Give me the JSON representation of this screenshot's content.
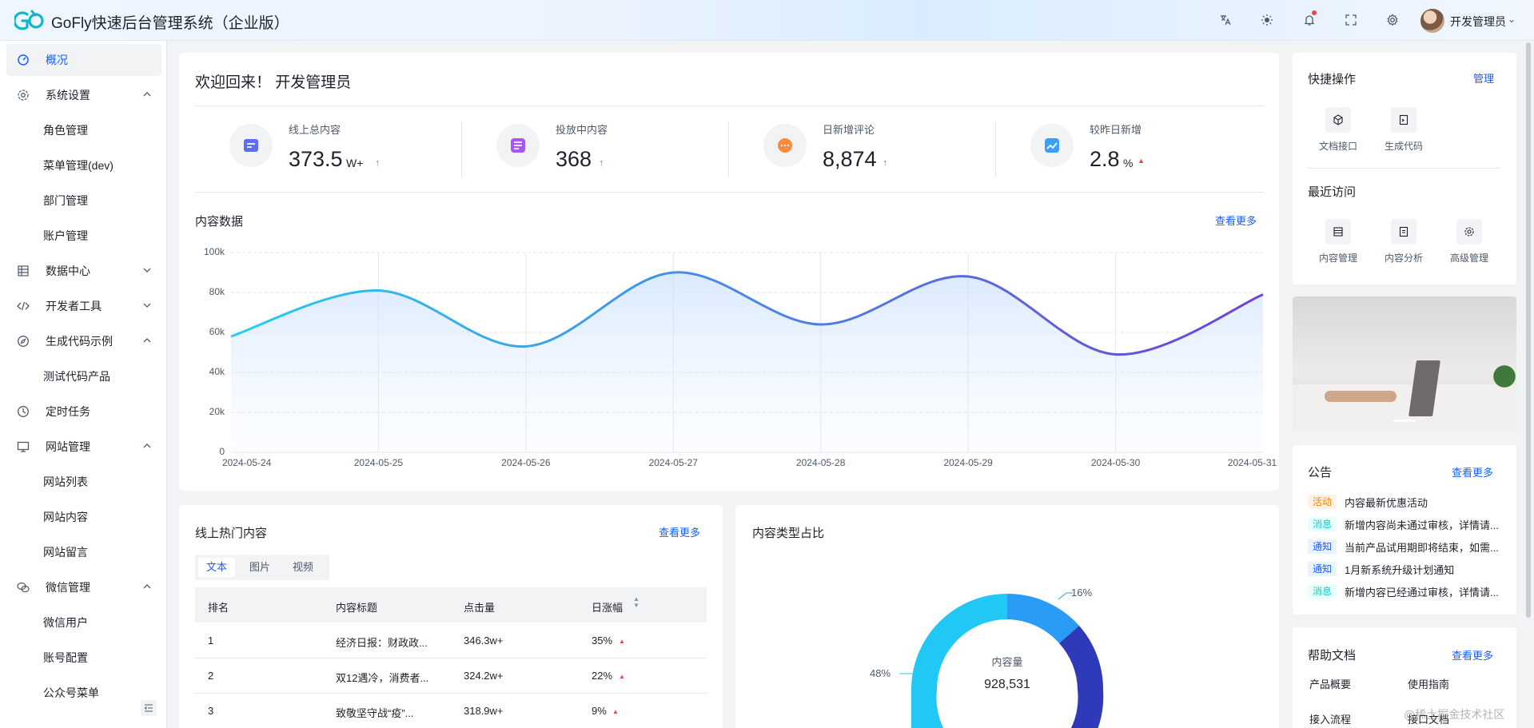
{
  "header": {
    "app_title": "GoFly快速后台管理系统（企业版）",
    "user_name": "开发管理员"
  },
  "sidebar": {
    "items": [
      {
        "label": "概况",
        "icon": "dashboard-icon"
      },
      {
        "label": "系统设置",
        "icon": "gear-icon"
      },
      {
        "label": "角色管理"
      },
      {
        "label": "菜单管理(dev)"
      },
      {
        "label": "部门管理"
      },
      {
        "label": "账户管理"
      },
      {
        "label": "数据中心",
        "icon": "database-icon"
      },
      {
        "label": "开发者工具",
        "icon": "code-icon"
      },
      {
        "label": "生成代码示例",
        "icon": "compass-icon"
      },
      {
        "label": "测试代码产品"
      },
      {
        "label": "定时任务",
        "icon": "clock-icon"
      },
      {
        "label": "网站管理",
        "icon": "desktop-icon"
      },
      {
        "label": "网站列表"
      },
      {
        "label": "网站内容"
      },
      {
        "label": "网站留言"
      },
      {
        "label": "微信管理",
        "icon": "wechat-icon"
      },
      {
        "label": "微信用户"
      },
      {
        "label": "账号配置"
      },
      {
        "label": "公众号菜单"
      }
    ]
  },
  "welcome": {
    "title": "欢迎回来！ 开发管理员",
    "stats": [
      {
        "label": "线上总内容",
        "value": "373.5",
        "unit": "W+",
        "color": "#5b6ef5"
      },
      {
        "label": "投放中内容",
        "value": "368",
        "unit": "",
        "color": "#a855f7"
      },
      {
        "label": "日新增评论",
        "value": "8,874",
        "unit": "",
        "color": "#ff8a3d"
      },
      {
        "label": "较昨日新增",
        "value": "2.8",
        "unit": "%",
        "color": "#3aa0ff"
      }
    ]
  },
  "content_data": {
    "title": "内容数据",
    "more": "查看更多"
  },
  "chart_data": {
    "type": "area",
    "x": [
      "2024-05-24",
      "2024-05-25",
      "2024-05-26",
      "2024-05-27",
      "2024-05-28",
      "2024-05-29",
      "2024-05-30",
      "2024-05-31"
    ],
    "values": [
      58000,
      81000,
      53000,
      90000,
      64000,
      88000,
      49000,
      79000
    ],
    "ylim": [
      0,
      100000
    ],
    "y_ticks": [
      "0",
      "20k",
      "40k",
      "60k",
      "80k",
      "100k"
    ],
    "grid": true,
    "colors": {
      "start": "#26ccf0",
      "end": "#6d42d8"
    }
  },
  "hot_content": {
    "title": "线上热门内容",
    "more": "查看更多",
    "tabs": [
      "文本",
      "图片",
      "视频"
    ],
    "columns": [
      "排名",
      "内容标题",
      "点击量",
      "日涨幅"
    ],
    "rows": [
      {
        "rank": "1",
        "title": "经济日报：财政政...",
        "clicks": "346.3w+",
        "growth": "35%"
      },
      {
        "rank": "2",
        "title": "双12遇冷，消费者...",
        "clicks": "324.2w+",
        "growth": "22%"
      },
      {
        "rank": "3",
        "title": "致敬坚守战“疫”...",
        "clicks": "318.9w+",
        "growth": "9%"
      }
    ]
  },
  "content_type": {
    "title": "内容类型占比",
    "center_label": "内容量",
    "center_value": "928,531",
    "labels": [
      "16%",
      "48%"
    ],
    "colors": [
      "#2a9cf5",
      "#2e3ab8",
      "#22c8f5"
    ]
  },
  "quick_ops": {
    "title": "快捷操作",
    "manage": "管理",
    "items": [
      {
        "label": "文档接口",
        "icon": "cube-icon"
      },
      {
        "label": "生成代码",
        "icon": "file-code-icon"
      }
    ]
  },
  "recent": {
    "title": "最近访问",
    "items": [
      {
        "label": "内容管理",
        "icon": "list-icon"
      },
      {
        "label": "内容分析",
        "icon": "doc-icon"
      },
      {
        "label": "高级管理",
        "icon": "settings-icon"
      }
    ]
  },
  "notice": {
    "title": "公告",
    "more": "查看更多",
    "items": [
      {
        "tag": "活动",
        "text": "内容最新优惠活动",
        "tag_color": "#ff7d00",
        "tag_bg": "#fff3e8"
      },
      {
        "tag": "消息",
        "text": "新增内容尚未通过审核，详情请...",
        "tag_color": "#14c9c9",
        "tag_bg": "#e8fffb"
      },
      {
        "tag": "通知",
        "text": "当前产品试用期即将结束，如需...",
        "tag_color": "#165dff",
        "tag_bg": "#e8f3ff"
      },
      {
        "tag": "通知",
        "text": "1月新系统升级计划通知",
        "tag_color": "#165dff",
        "tag_bg": "#e8f3ff"
      },
      {
        "tag": "消息",
        "text": "新增内容已经通过审核，详情请...",
        "tag_color": "#14c9c9",
        "tag_bg": "#e8fffb"
      }
    ]
  },
  "help_docs": {
    "title": "帮助文档",
    "more": "查看更多",
    "links": [
      "产品概要",
      "使用指南",
      "接入流程",
      "接口文档"
    ]
  },
  "watermark": "@稀土掘金技术社区"
}
